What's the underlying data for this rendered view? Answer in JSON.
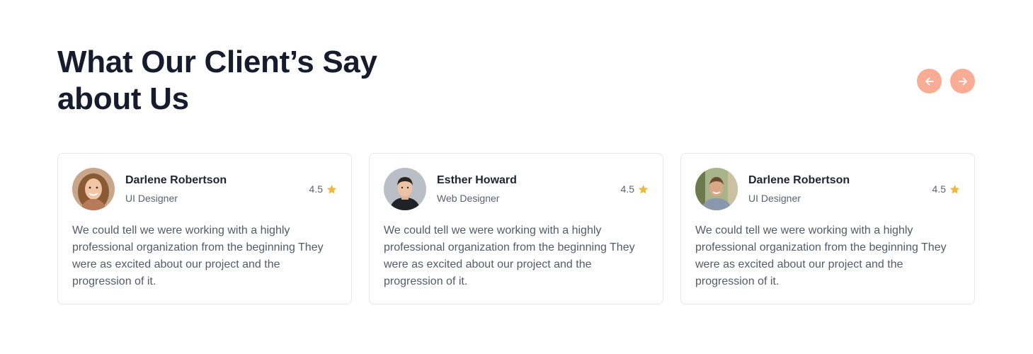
{
  "section": {
    "title": "What Our Client’s Say about Us"
  },
  "nav": {
    "prev_icon": "arrow-left-icon",
    "next_icon": "arrow-right-icon",
    "accent_color": "#f8ac94"
  },
  "testimonials": [
    {
      "name": "Darlene Robertson",
      "role": "UI Designer",
      "rating": "4.5",
      "quote": "We could tell we were working with a highly professional organization from the beginning They were as excited about our project and the progression of it."
    },
    {
      "name": "Esther Howard",
      "role": "Web Designer",
      "rating": "4.5",
      "quote": "We could tell we were working with a highly professional organization from the beginning They were as excited about our project and the progression of it."
    },
    {
      "name": "Darlene Robertson",
      "role": "UI Designer",
      "rating": "4.5",
      "quote": "We could tell we were working with a highly professional organization from the beginning They were as excited about our project and the progression of it."
    }
  ],
  "star_color": "#f5b731"
}
